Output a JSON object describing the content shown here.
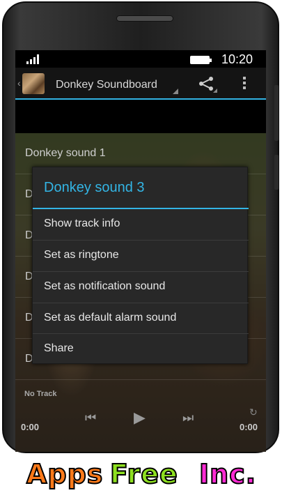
{
  "status_bar": {
    "time": "10:20"
  },
  "action_bar": {
    "title": "Donkey Soundboard"
  },
  "list": {
    "items": [
      {
        "label": "Donkey sound 1"
      },
      {
        "label": "D"
      },
      {
        "label": "D"
      },
      {
        "label": "D"
      },
      {
        "label": "D"
      },
      {
        "label": "D"
      }
    ]
  },
  "player": {
    "track": "No Track",
    "elapsed": "0:00",
    "duration": "0:00"
  },
  "dialog": {
    "title": "Donkey sound 3",
    "items": [
      {
        "label": "Show track info"
      },
      {
        "label": "Set as ringtone"
      },
      {
        "label": "Set as notification sound"
      },
      {
        "label": "Set as default alarm sound"
      },
      {
        "label": "Share"
      }
    ]
  },
  "footer": {
    "apps": "Apps",
    "free": "Free",
    "inc": "Inc."
  },
  "colors": {
    "accent": "#33b5e5",
    "dialog_bg": "#282828",
    "logo_apps": "#ff7a1a",
    "logo_free": "#8ee020",
    "logo_inc": "#ff2ad4"
  },
  "icons": [
    "signal-icon",
    "battery-icon",
    "back-icon",
    "app-icon",
    "share-icon",
    "overflow-icon",
    "previous-icon",
    "play-icon",
    "next-icon"
  ]
}
